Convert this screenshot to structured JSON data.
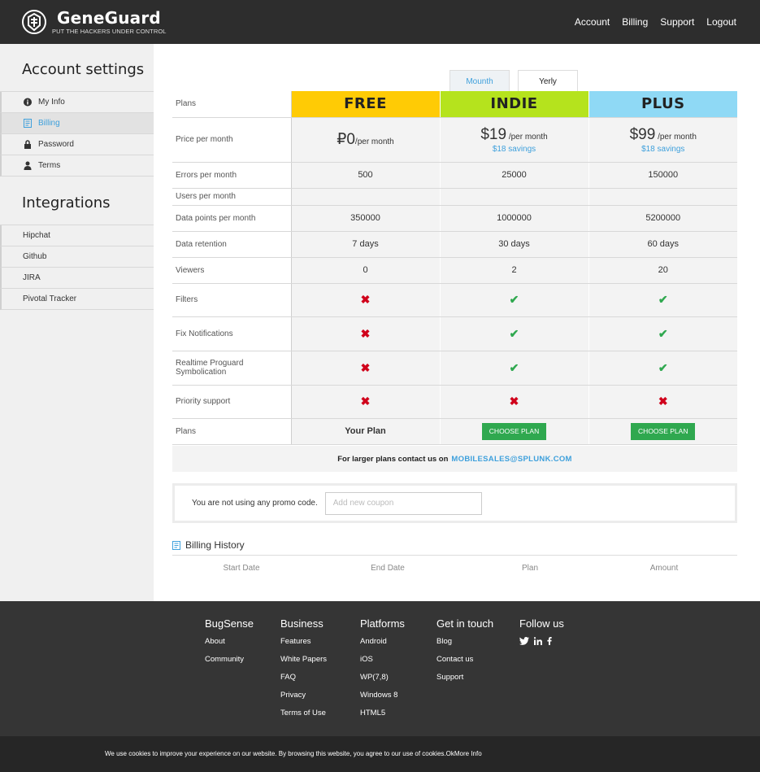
{
  "header": {
    "brand": "GeneGuard",
    "tagline": "PUT THE HACKERS UNDER CONTROL",
    "nav": [
      "Account",
      "Billing",
      "Support",
      "Logout"
    ]
  },
  "sidebar": {
    "account_title": "Account settings",
    "account_items": [
      {
        "label": "My Info",
        "icon": "info-icon"
      },
      {
        "label": "Billing",
        "icon": "document-icon",
        "active": true
      },
      {
        "label": "Password",
        "icon": "lock-icon"
      },
      {
        "label": "Terms",
        "icon": "user-icon"
      }
    ],
    "integrations_title": "Integrations",
    "integration_items": [
      "Hipchat",
      "Github",
      "JIRA",
      "Pivotal Tracker"
    ]
  },
  "period_tabs": {
    "monthly": "Mounth",
    "yearly": "Yerly",
    "active": "yearly"
  },
  "plans": {
    "row_labels": {
      "plans": "Plans",
      "price": "Price per month",
      "errors": "Errors per month",
      "users": "Users per month",
      "datapoints": "Data points per month",
      "retention": "Data retention",
      "viewers": "Viewers",
      "filters": "Filters",
      "fix_notifications": "Fix Notifications",
      "realtime": "Realtime Proguard Symbolication",
      "priority": "Priority support",
      "plans_bottom": "Plans"
    },
    "free": {
      "name": "FREE",
      "price": "₽0",
      "per": "/per month",
      "errors": "500",
      "datapoints": "350000",
      "retention": "7 days",
      "viewers": "0",
      "action": "Your Plan"
    },
    "indie": {
      "name": "INDIE",
      "price": "$19",
      "per": " /per month",
      "savings": "$18 savings",
      "errors": "25000",
      "datapoints": "1000000",
      "retention": "30 days",
      "viewers": "2",
      "action": "CHOOSE PLAN"
    },
    "plus": {
      "name": "PLUS",
      "price": "$99",
      "per": " /per month",
      "savings": "$18 savings",
      "errors": "150000",
      "datapoints": "5200000",
      "retention": "60 days",
      "viewers": "20",
      "action": "CHOOSE PLAN"
    },
    "features": {
      "filters": [
        false,
        true,
        true
      ],
      "fix_notifications": [
        false,
        true,
        true
      ],
      "realtime": [
        false,
        true,
        true
      ],
      "priority": [
        false,
        false,
        false
      ]
    },
    "colors": {
      "free": "#ffcb05",
      "indie": "#b5e31d",
      "plus": "#8fd9f5"
    }
  },
  "contact": {
    "text": "For larger plans contact us on",
    "email": "MOBILESALES@SPLUNK.COM"
  },
  "promo": {
    "text": "You are not using any promo code.",
    "placeholder": "Add new coupon"
  },
  "billing_history": {
    "title": "Billing History",
    "columns": [
      "Start Date",
      "End Date",
      "Plan",
      "Amount"
    ]
  },
  "footer": {
    "columns": [
      {
        "title": "BugSense",
        "links": [
          "About",
          "Community"
        ]
      },
      {
        "title": "Business",
        "links": [
          "Features",
          "White Papers",
          "FAQ",
          "Privacy",
          "Terms of Use"
        ]
      },
      {
        "title": "Platforms",
        "links": [
          "Android",
          "iOS",
          "WP(7,8)",
          "Windows 8",
          "HTML5"
        ]
      },
      {
        "title": "Get in touch",
        "links": [
          "Blog",
          "Contact us",
          "Support"
        ]
      },
      {
        "title": "Follow us",
        "social": [
          "twitter-icon",
          "linkedin-icon",
          "facebook-icon"
        ]
      }
    ]
  },
  "cookie": {
    "text": "We use cookies to improve your experience on our website. By browsing this website, you agree to our use of cookies.OkMore Info"
  }
}
